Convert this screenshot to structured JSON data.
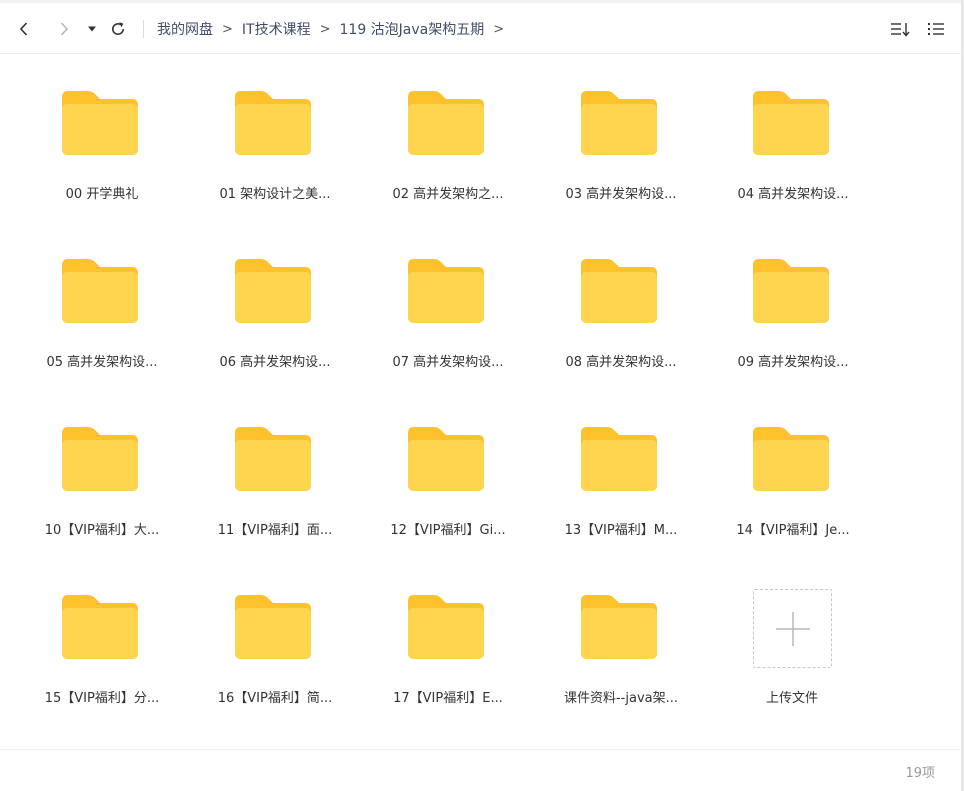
{
  "toolbar": {
    "back_icon": "chevron-left-icon",
    "forward_icon": "chevron-right-icon",
    "history_dropdown_icon": "triangle-down-icon",
    "refresh_icon": "refresh-icon",
    "sort_icon": "sort-icon",
    "list_view_icon": "list-view-icon"
  },
  "breadcrumb": {
    "items": [
      "我的网盘",
      "IT技术课程",
      "119 沽泡Java架构五期"
    ],
    "separator": ">"
  },
  "folders": [
    {
      "name": "00 开学典礼"
    },
    {
      "name": "01 架构设计之美..."
    },
    {
      "name": "02 高并发架构之..."
    },
    {
      "name": "03 高并发架构设..."
    },
    {
      "name": "04 高并发架构设..."
    },
    {
      "name": "05 高并发架构设..."
    },
    {
      "name": "06 高并发架构设..."
    },
    {
      "name": "07 高并发架构设..."
    },
    {
      "name": "08 高并发架构设..."
    },
    {
      "name": "09 高并发架构设..."
    },
    {
      "name": "10【VIP福利】大..."
    },
    {
      "name": "11【VIP福利】面..."
    },
    {
      "name": "12【VIP福利】Gi..."
    },
    {
      "name": "13【VIP福利】M..."
    },
    {
      "name": "14【VIP福利】Je..."
    },
    {
      "name": "15【VIP福利】分..."
    },
    {
      "name": "16【VIP福利】简..."
    },
    {
      "name": "17【VIP福利】E..."
    },
    {
      "name": "课件资料--java架..."
    }
  ],
  "upload": {
    "label": "上传文件",
    "icon": "plus-icon"
  },
  "footer": {
    "item_count": "19项"
  },
  "colors": {
    "folder_body": "#ffd44f",
    "folder_tab": "#ffc22d",
    "breadcrumb_text": "#424e67"
  }
}
